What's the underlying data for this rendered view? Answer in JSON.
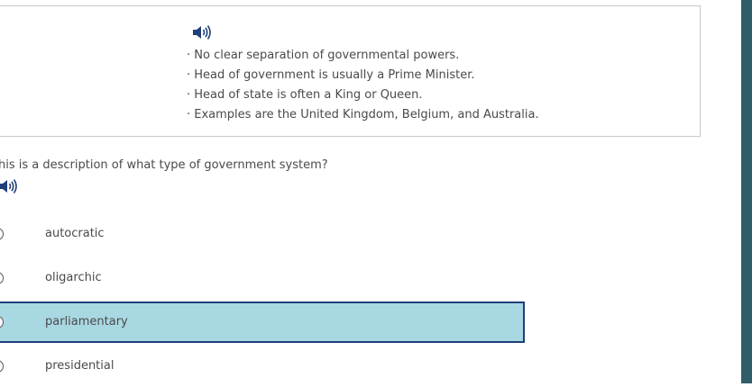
{
  "passage": {
    "lines": [
      "· No clear separation of governmental powers.",
      "· Head of government is usually a Prime Minister.",
      "· Head of state is often a King or Queen.",
      "· Examples are the United Kingdom, Belgium, and Australia."
    ]
  },
  "question": {
    "text": "his is a description of what type of government system?"
  },
  "answers": [
    {
      "label": "autocratic",
      "selected": false
    },
    {
      "label": "oligarchic",
      "selected": false
    },
    {
      "label": "parliamentary",
      "selected": true
    },
    {
      "label": "presidential",
      "selected": false
    }
  ],
  "icons": {
    "audio": "speaker-icon"
  },
  "colors": {
    "selected_bg": "#a8d8e2",
    "selected_border": "#1f3f7a",
    "icon": "#1f3f7a",
    "sidebar": "#2f5d6a"
  }
}
